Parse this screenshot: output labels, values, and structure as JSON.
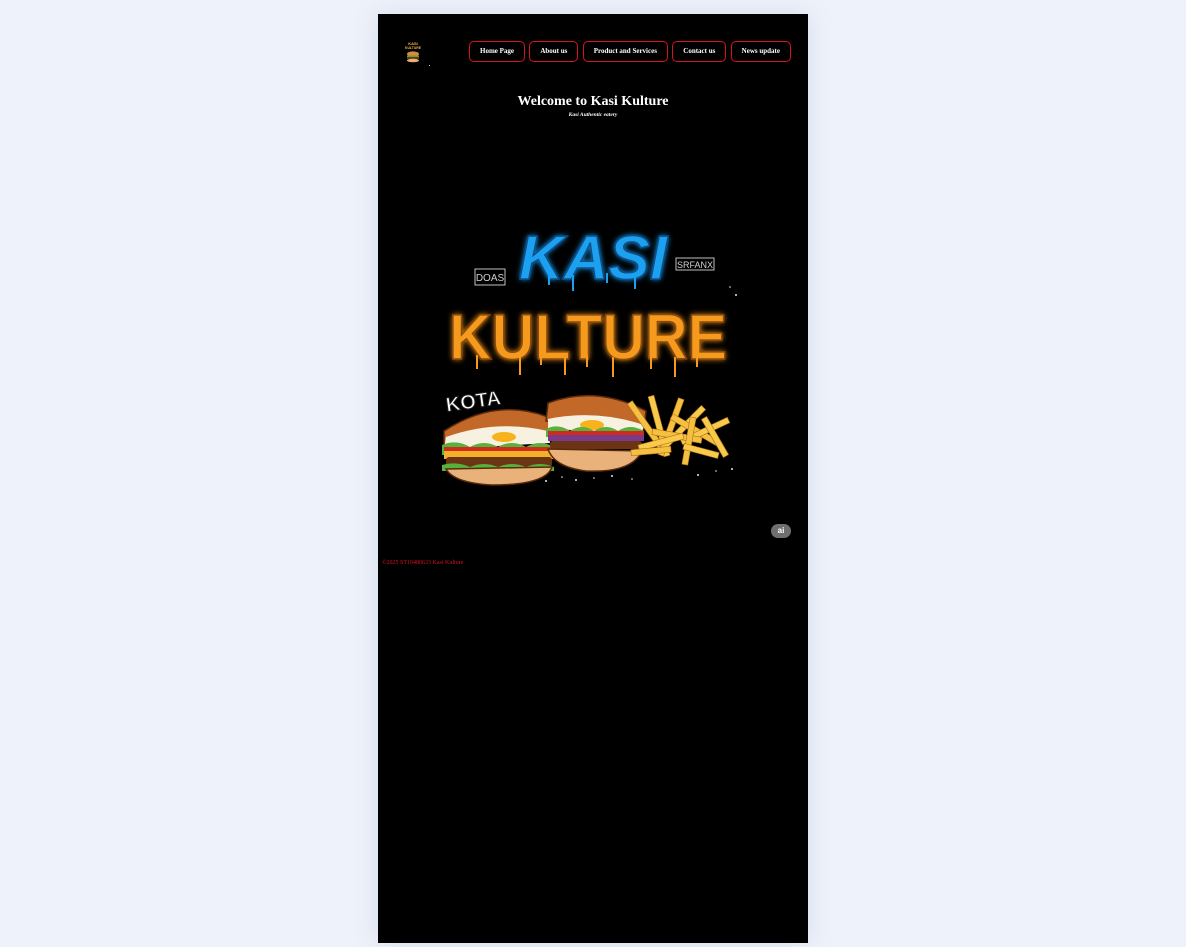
{
  "header": {
    "logo": {
      "icon": "kasi-kulture-logo-icon",
      "text_top": "KASI",
      "text_bottom": "KULTURE"
    },
    "nav": [
      {
        "label": "Home Page"
      },
      {
        "label": "About us"
      },
      {
        "label": "Product and Services"
      },
      {
        "label": "Contact us"
      },
      {
        "label": "News update"
      }
    ]
  },
  "hero": {
    "title": "Welcome to Kasi Kulture",
    "subtitle": "Kasi Authentic eatery",
    "artwork": {
      "word_top": "KASI",
      "word_bottom": "KULTURE",
      "tag_left": "DOAS",
      "tag_right": "SRFANX",
      "sticker": "KOTA"
    }
  },
  "ai_badge": {
    "label": "ai"
  },
  "footer": {
    "text": "©2025 ST10480633 Kasi Kulture"
  },
  "colors": {
    "page_background": "#eef2fa",
    "site_background": "#000000",
    "accent_red": "#d4141e",
    "graffiti_blue": "#1ea0f0",
    "graffiti_orange": "#f59a1c"
  }
}
